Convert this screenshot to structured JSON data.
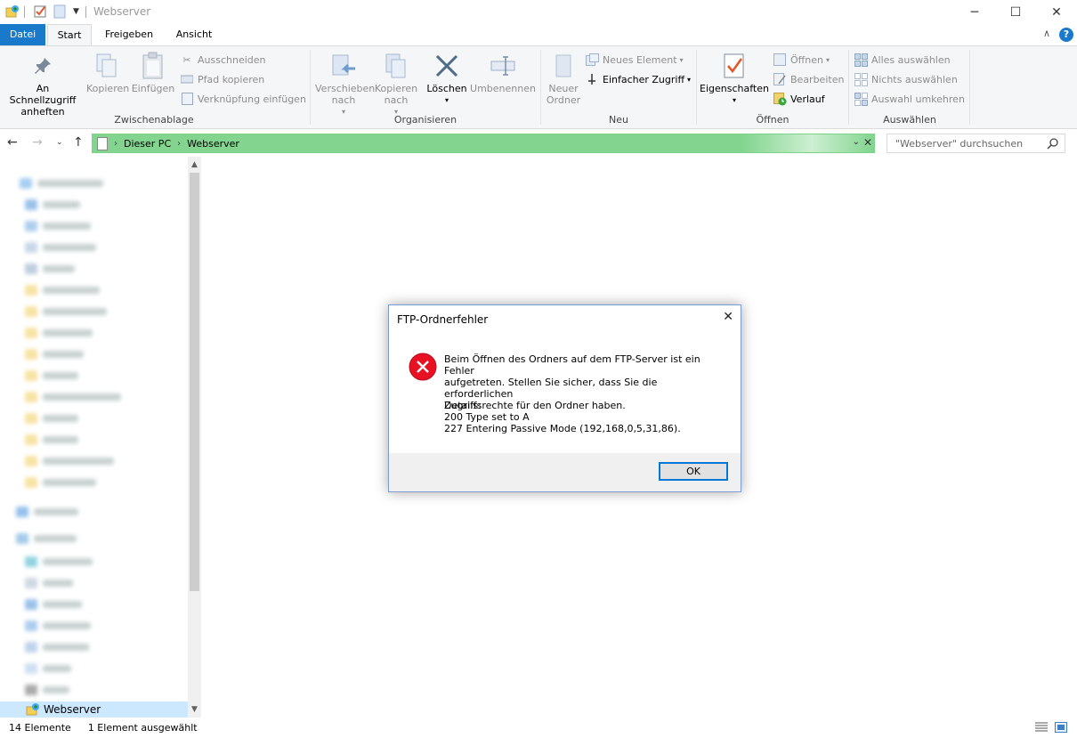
{
  "window": {
    "title": "Webserver"
  },
  "tabs": {
    "file": "Datei",
    "start": "Start",
    "share": "Freigeben",
    "view": "Ansicht"
  },
  "ribbon": {
    "clipboard": {
      "label": "Zwischenablage",
      "pin": "An Schnellzugriff anheften",
      "copy": "Kopieren",
      "paste": "Einfügen",
      "cut": "Ausschneiden",
      "copy_path": "Pfad kopieren",
      "paste_shortcut": "Verknüpfung einfügen"
    },
    "organize": {
      "label": "Organisieren",
      "move_to": "Verschieben nach",
      "copy_to": "Kopieren nach",
      "delete": "Löschen",
      "rename": "Umbenennen"
    },
    "new": {
      "label": "Neu",
      "new_folder": "Neuer Ordner",
      "new_item": "Neues Element",
      "easy_access": "Einfacher Zugriff"
    },
    "open": {
      "label": "Öffnen",
      "properties": "Eigenschaften",
      "open": "Öffnen",
      "edit": "Bearbeiten",
      "history": "Verlauf"
    },
    "select": {
      "label": "Auswählen",
      "select_all": "Alles auswählen",
      "select_none": "Nichts auswählen",
      "invert": "Auswahl umkehren"
    }
  },
  "address": {
    "crumbs": [
      "Dieser PC",
      "Webserver"
    ],
    "search_placeholder": "\"Webserver\" durchsuchen"
  },
  "navpane": {
    "selected_item": "Webserver"
  },
  "statusbar": {
    "count": "14 Elemente",
    "selection": "1 Element ausgewählt"
  },
  "dialog": {
    "title": "FTP-Ordnerfehler",
    "message_lines": [
      "Beim Öffnen des Ordners auf dem FTP-Server ist ein Fehler",
      "aufgetreten. Stellen Sie sicher, dass Sie die erforderlichen",
      "Zugriffsrechte für den Ordner haben."
    ],
    "details_lines": [
      "Details:",
      "200 Type set to A",
      "227 Entering Passive Mode (192,168,0,5,31,86)."
    ],
    "ok": "OK"
  },
  "colors": {
    "accent": "#1979ca",
    "address_loading": "#82d48e",
    "selection": "#cce8ff",
    "error": "#e81123"
  }
}
